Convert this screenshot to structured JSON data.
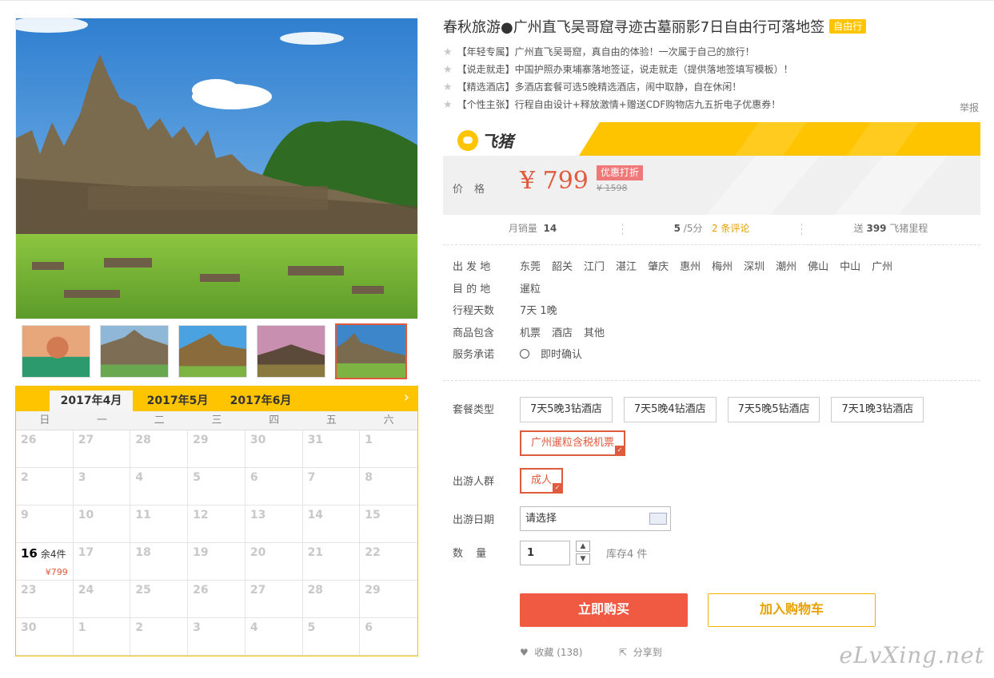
{
  "title": "春秋旅游●广州直飞吴哥窟寻迹古墓丽影7日自由行可落地签",
  "title_badge": "自由行",
  "features": [
    "【年轻专属】广州直飞吴哥窟，真自由的体验！一次属于自己的旅行！",
    "【说走就走】中国护照办柬埔寨落地签证，说走就走（提供落地签填写模板）！",
    "【精选酒店】多酒店套餐可选5晚精选酒店，闹中取静，自在休闲！",
    "【个性主张】行程自由设计+释放激情+赠送CDF购物店九五折电子优惠券！"
  ],
  "report": "举报",
  "brand": {
    "name": "飞猪"
  },
  "price": {
    "label": "价格",
    "value": "¥ 799",
    "discount_badge": "优惠打折",
    "original": "¥ 1598"
  },
  "stats": {
    "monthly_sales_label": "月销量",
    "monthly_sales": "14",
    "rating": "5",
    "rating_suffix": "/5分",
    "reviews": "2 条评论",
    "mileage_prefix": "送",
    "mileage": "399",
    "mileage_suffix": "飞猪里程"
  },
  "info": {
    "depart_label": "出 发 地",
    "depart": [
      "东莞",
      "韶关",
      "江门",
      "湛江",
      "肇庆",
      "惠州",
      "梅州",
      "深圳",
      "潮州",
      "佛山",
      "中山",
      "广州"
    ],
    "dest_label": "目 的 地",
    "dest": "暹粒",
    "days_label": "行程天数",
    "days": "7天 1晚",
    "includes_label": "商品包含",
    "includes": [
      "机票",
      "酒店",
      "其他"
    ],
    "service_label": "服务承诺",
    "service": "即时确认"
  },
  "package": {
    "label": "套餐类型",
    "options": [
      "7天5晚3钻酒店",
      "7天5晚4钻酒店",
      "7天5晚5钻酒店",
      "7天1晚3钻酒店",
      "广州暹粒含税机票"
    ],
    "selected_index": 4
  },
  "crowd": {
    "label": "出游人群",
    "options": [
      "成人"
    ],
    "selected_index": 0
  },
  "date": {
    "label": "出游日期",
    "value": "请选择"
  },
  "quantity": {
    "label": "数 量",
    "value": "1",
    "stock": "库存4 件"
  },
  "buttons": {
    "buy": "立即购买",
    "cart": "加入购物车"
  },
  "fav": "收藏 (138)",
  "share": "分享到",
  "watermark": "eLvXing.net",
  "calendar": {
    "months": [
      "2017年4月",
      "2017年5月",
      "2017年6月"
    ],
    "active_month_index": 0,
    "weekdays": [
      "日",
      "一",
      "二",
      "三",
      "四",
      "五",
      "六"
    ],
    "days": [
      "26",
      "27",
      "28",
      "29",
      "30",
      "31",
      "1",
      "2",
      "3",
      "4",
      "5",
      "6",
      "7",
      "8",
      "9",
      "10",
      "11",
      "12",
      "13",
      "14",
      "15",
      "16",
      "17",
      "18",
      "19",
      "20",
      "21",
      "22",
      "23",
      "24",
      "25",
      "26",
      "27",
      "28",
      "29",
      "30",
      "1",
      "2",
      "3",
      "4",
      "5",
      "6"
    ],
    "available": {
      "index": 21,
      "stock": "余4件",
      "price": "¥799"
    }
  },
  "colors": {
    "accent": "#e05a3d",
    "brand_yellow": "#ffc400",
    "cart_orange": "#e8a000"
  }
}
